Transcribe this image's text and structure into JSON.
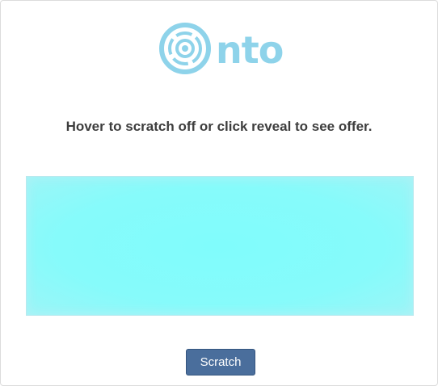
{
  "brand": {
    "logo_text": "nto",
    "logo_color": "#8ed3ea"
  },
  "instruction": "Hover to scratch off or click reveal to see offer.",
  "scratch_area": {
    "color": "#80fcfc"
  },
  "actions": {
    "scratch_label": "Scratch",
    "button_color": "#4a6e9c"
  }
}
